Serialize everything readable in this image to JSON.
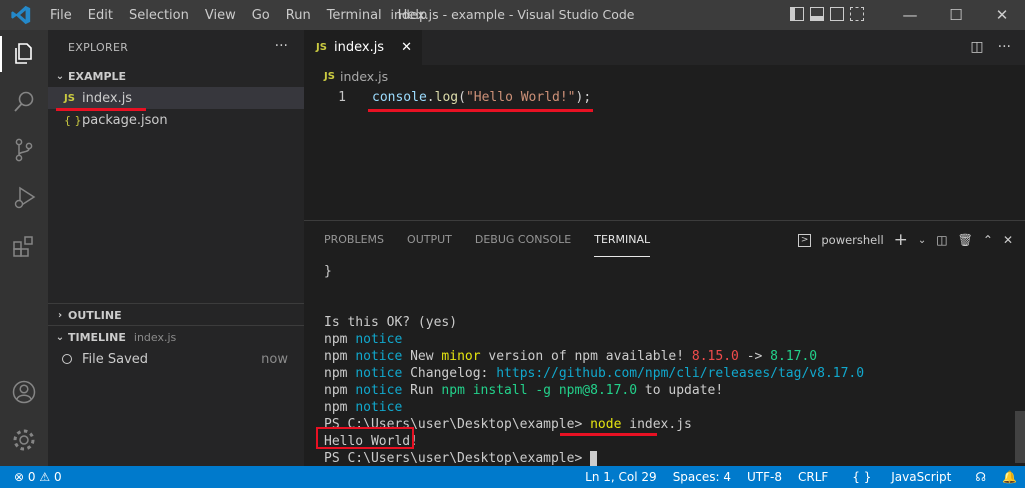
{
  "window": {
    "title": "index.js - example - Visual Studio Code",
    "menu": [
      "File",
      "Edit",
      "Selection",
      "View",
      "Go",
      "Run",
      "Terminal",
      "Help"
    ]
  },
  "sidebar": {
    "header": "EXPLORER",
    "more": "···",
    "folder": "EXAMPLE",
    "files": [
      {
        "badge": "JS",
        "name": "index.js"
      },
      {
        "badge": "{ }",
        "name": "package.json"
      }
    ],
    "outline_label": "OUTLINE",
    "timeline_label": "TIMELINE",
    "timeline_file": "index.js",
    "timeline_item": "File Saved",
    "timeline_time": "now"
  },
  "editor": {
    "tab_badge": "JS",
    "tab_label": "index.js",
    "breadcrumb": "index.js",
    "line_number": "1",
    "code": {
      "obj": "console",
      "dot": ".",
      "fn": "log",
      "open": "(",
      "str": "\"Hello World!\"",
      "close": ");"
    }
  },
  "panel": {
    "tabs": [
      "PROBLEMS",
      "OUTPUT",
      "DEBUG CONSOLE",
      "TERMINAL"
    ],
    "shell": "powershell",
    "terminal": {
      "brace": "}",
      "ok": "Is this OK? (yes)",
      "npm": "npm",
      "notice": "notice",
      "l2_a": "New",
      "l2_minor": "minor",
      "l2_b": "version of npm available!",
      "l2_old": "8.15.0",
      "l2_arrow": "->",
      "l2_new": "8.17.0",
      "l3_a": "Changelog:",
      "l3_url": "https://github.com/npm/cli/releases/tag/v8.17.0",
      "l4_a": "Run",
      "l4_cmd": "npm install -g npm@8.17.0",
      "l4_b": "to update!",
      "prompt": "PS C:\\Users\\user\\Desktop\\example>",
      "cmd_node": "node",
      "cmd_arg": "index.js",
      "output": "Hello World!"
    }
  },
  "status": {
    "errors": "0",
    "warnings": "0",
    "position": "Ln 1, Col 29",
    "spaces": "Spaces: 4",
    "encoding": "UTF-8",
    "eol": "CRLF",
    "language": "JavaScript"
  },
  "colors": {
    "accent": "#007acc",
    "annotation": "#e81123"
  }
}
